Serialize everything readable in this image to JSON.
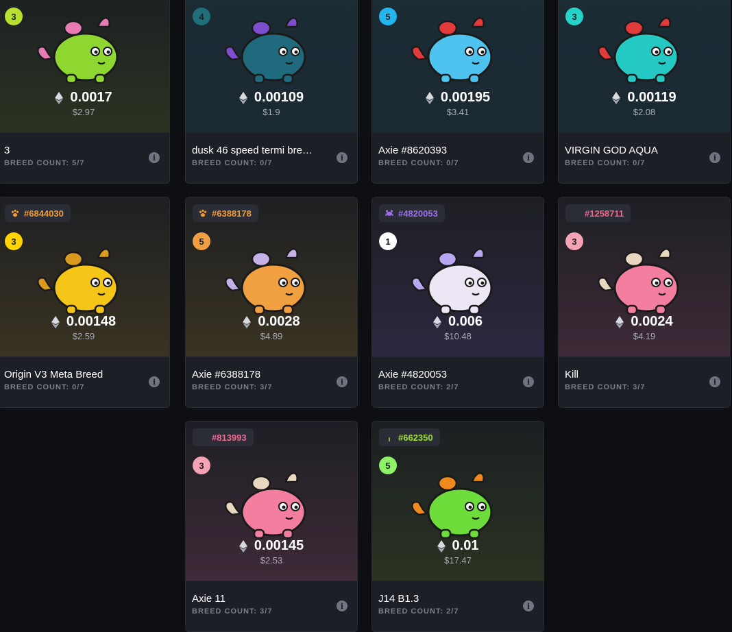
{
  "cards": [
    {
      "stage": "3",
      "stage_bg": "#b8e02e",
      "stage_fg": "#1c1f26",
      "bg_from": "#1a1d22",
      "bg_to": "#2a3322",
      "body": "#8ed630",
      "accent": "#e87bb4",
      "price_eth": "0.0017",
      "price_usd": "$2.97",
      "name": "3",
      "breed": "BREED COUNT: 5/7"
    },
    {
      "stage": "4",
      "stage_bg": "#1f6e7a",
      "stage_fg": "#1c1f26",
      "bg_from": "#1b2c35",
      "bg_to": "#1b2932",
      "body": "#1f6b7d",
      "accent": "#7d4fcf",
      "price_eth": "0.00109",
      "price_usd": "$1.9",
      "name": "dusk 46 speed termi bre…",
      "breed": "BREED COUNT: 0/7"
    },
    {
      "stage": "5",
      "stage_bg": "#22b5ee",
      "stage_fg": "#1c1f26",
      "bg_from": "#1b2c35",
      "bg_to": "#1b2932",
      "body": "#4fc3f0",
      "accent": "#e23b3b",
      "price_eth": "0.00195",
      "price_usd": "$3.41",
      "name": "Axie #8620393",
      "breed": "BREED COUNT: 0/7"
    },
    {
      "stage": "3",
      "stage_bg": "#24d4c8",
      "stage_fg": "#1c1f26",
      "bg_from": "#1b2c35",
      "bg_to": "#1b2932",
      "body": "#25c9c4",
      "accent": "#e23b3b",
      "price_eth": "0.00119",
      "price_usd": "$2.08",
      "name": "VIRGIN GOD AQUA",
      "breed": "BREED COUNT: 0/7"
    },
    {
      "tag_id": "#6844030",
      "tag_color": "#f39a2e",
      "tag_icon": "paw",
      "stage": "3",
      "stage_bg": "#ffd400",
      "stage_fg": "#1c1f26",
      "bg_from": "#1d1f22",
      "bg_to": "#3a3322",
      "body": "#f5c518",
      "accent": "#d99a1e",
      "price_eth": "0.00148",
      "price_usd": "$2.59",
      "name": "Origin V3 Meta Breed",
      "breed": "BREED COUNT: 0/7"
    },
    {
      "tag_id": "#6388178",
      "tag_color": "#f39a2e",
      "tag_icon": "paw",
      "stage": "5",
      "stage_bg": "#f0a040",
      "stage_fg": "#1c1f26",
      "bg_from": "#1d1f22",
      "bg_to": "#3a3322",
      "body": "#f0a040",
      "accent": "#c6b0e8",
      "price_eth": "0.0028",
      "price_usd": "$4.89",
      "name": "Axie #6388178",
      "breed": "BREED COUNT: 3/7"
    },
    {
      "tag_id": "#4820053",
      "tag_color": "#9a6cf0",
      "tag_icon": "bug",
      "stage": "1",
      "stage_bg": "#ffffff",
      "stage_fg": "#1c1f26",
      "bg_from": "#1d1f24",
      "bg_to": "#2c2740",
      "body": "#ece6f5",
      "accent": "#b9a6f0",
      "price_eth": "0.006",
      "price_usd": "$10.48",
      "name": "Axie #4820053",
      "breed": "BREED COUNT: 2/7"
    },
    {
      "tag_id": "#1258711",
      "tag_color": "#f2658f",
      "tag_icon": "feather",
      "stage": "3",
      "stage_bg": "#f7a3b6",
      "stage_fg": "#1c1f26",
      "bg_from": "#1d1f24",
      "bg_to": "#3e2a38",
      "body": "#f47ea0",
      "accent": "#e8d8c0",
      "price_eth": "0.0024",
      "price_usd": "$4.19",
      "name": "Kill",
      "breed": "BREED COUNT: 3/7"
    },
    {
      "tag_id": "#813993",
      "tag_color": "#f2658f",
      "tag_icon": "feather",
      "stage": "3",
      "stage_bg": "#f7a3b6",
      "stage_fg": "#1c1f26",
      "bg_from": "#1d1f24",
      "bg_to": "#3e2a38",
      "body": "#f47ea0",
      "accent": "#e8d8c0",
      "price_eth": "0.00145",
      "price_usd": "$2.53",
      "name": "Axie 11",
      "breed": "BREED COUNT: 3/7"
    },
    {
      "tag_id": "#662350",
      "tag_color": "#9be02e",
      "tag_icon": "sprout",
      "stage": "5",
      "stage_bg": "#8ff266",
      "stage_fg": "#1c1f26",
      "bg_from": "#1b1f22",
      "bg_to": "#2a3322",
      "body": "#6edc3a",
      "accent": "#f08a1e",
      "price_eth": "0.01",
      "price_usd": "$17.47",
      "name": "J14 B1.3",
      "breed": "BREED COUNT: 2/7"
    }
  ]
}
